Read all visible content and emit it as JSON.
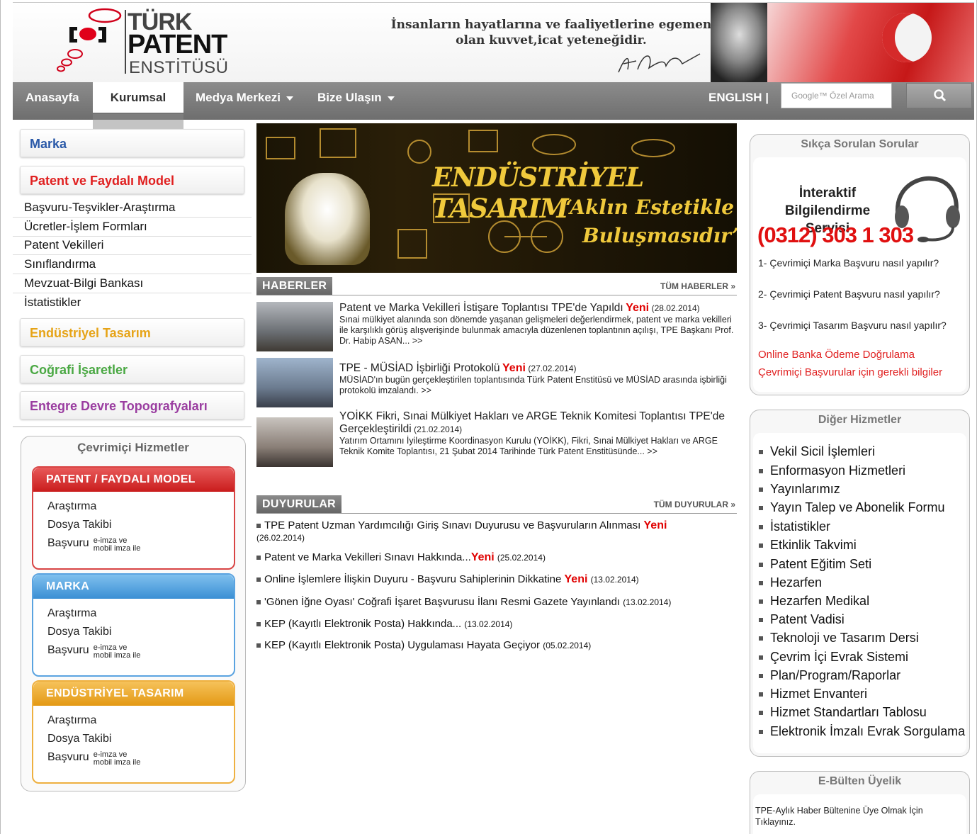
{
  "header": {
    "logo_line1": "TÜRK",
    "logo_line2": "PATENT",
    "logo_line3": "ENSTİTÜSÜ",
    "quote_line1": "İnsanların hayatlarına ve faaliyetlerine egemen",
    "quote_line2": "olan kuvvet,icat yeteneğidir."
  },
  "nav": {
    "items": [
      "Anasayfa",
      "Kurumsal",
      "Medya Merkezi",
      "Bize Ulaşın"
    ],
    "english": "ENGLISH |",
    "search_placeholder": "Google™ Özel Arama"
  },
  "left": {
    "buttons": [
      "Marka",
      "Patent ve Faydalı Model",
      "Endüstriyel Tasarım",
      "Coğrafi İşaretler",
      "Entegre Devre Topografyaları"
    ],
    "links": [
      "Başvuru-Teşvikler-Araştırma",
      "Ücretler-İşlem Formları",
      "Patent Vekilleri",
      "Sınıflandırma",
      "Mevzuat-Bilgi Bankası",
      "İstatistikler"
    ],
    "online_title": "Çevrimiçi Hizmetler",
    "boxes": [
      {
        "title": "PATENT / FAYDALI MODEL",
        "l1": "Araştırma",
        "l2": "Dosya Takibi",
        "l3": "Başvuru",
        "small1": "e-imza ve",
        "small2": "mobil imza ile"
      },
      {
        "title": "MARKA",
        "l1": "Araştırma",
        "l2": "Dosya Takibi",
        "l3": "Başvuru",
        "small1": "e-imza ve",
        "small2": "mobil imza ile"
      },
      {
        "title": "ENDÜSTRİYEL TASARIM",
        "l1": "Araştırma",
        "l2": "Dosya Takibi",
        "l3": "Başvuru",
        "small1": "e-imza ve",
        "small2": "mobil imza ile"
      }
    ]
  },
  "banner": {
    "line1": "ENDÜSTRİYEL TASARIM",
    "line2": "“Aklın Estetikle",
    "line3": "Buluşmasıdır”"
  },
  "news": {
    "tag": "HABERLER",
    "all": "TÜM HABERLER »",
    "yeni": "Yeni",
    "items": [
      {
        "title": "Patent ve Marka Vekilleri İstişare Toplantısı TPE'de Yapıldı",
        "date": "(28.02.2014)",
        "body": "Sınai mülkiyet alanında son dönemde yaşanan gelişmeleri değerlendirmek, patent ve marka vekilleri ile karşılıklı görüş alışverişinde bulunmak amacıyla düzenlenen toplantının açılışı, TPE Başkanı Prof. Dr. Habip ASAN... >>"
      },
      {
        "title": "TPE - MÜSİAD İşbirliği Protokolü",
        "date": "(27.02.2014)",
        "body": "MÜSİAD'ın bugün gerçekleştirilen toplantısında Türk Patent Enstitüsü ve MÜSİAD arasında işbirliği protokolü imzalandı. >>"
      },
      {
        "title": "YOİKK Fikri, Sınai Mülkiyet Hakları ve ARGE Teknik Komitesi Toplantısı TPE'de Gerçekleştirildi",
        "date": "(21.02.2014)",
        "body": "Yatırım Ortamını İyileştirme Koordinasyon Kurulu (YOİKK), Fikri, Sınai Mülkiyet Hakları ve ARGE Teknik Komite Toplantısı, 21 Şubat 2014 Tarihinde Türk Patent Enstitüsünde... >>"
      }
    ]
  },
  "announcements": {
    "tag": "DUYURULAR",
    "all": "TÜM DUYURULAR »",
    "items": [
      {
        "title": "TPE Patent Uzman Yardımcılığı Giriş Sınavı Duyurusu ve Başvuruların Alınması",
        "yeni": "Yeni",
        "date": "(26.02.2014)"
      },
      {
        "title": "Patent ve Marka Vekilleri Sınavı Hakkında...",
        "yeni": "Yeni",
        "date": "(25.02.2014)"
      },
      {
        "title": "Online İşlemlere İlişkin Duyuru - Başvuru Sahiplerinin Dikkatine",
        "yeni": "Yeni",
        "date": "(13.02.2014)"
      },
      {
        "title": "'Gönen İğne Oyası' Coğrafi İşaret Başvurusu İlanı Resmi Gazete Yayınlandı",
        "yeni": "",
        "date": "(13.02.2014)"
      },
      {
        "title": "KEP (Kayıtlı Elektronik Posta) Hakkında...",
        "yeni": "",
        "date": "(13.02.2014)"
      },
      {
        "title": "KEP (Kayıtlı Elektronik Posta) Uygulaması Hayata Geçiyor",
        "yeni": "",
        "date": "(05.02.2014)"
      }
    ]
  },
  "faq": {
    "title": "Sıkça Sorulan Sorular",
    "service_line1": "İnteraktif Bilgilendirme",
    "service_line2": "Servisi",
    "phone": "(0312) 303 1 303",
    "q1": "1- Çevrimiçi Marka Başvuru nasıl yapılır?",
    "q2": "2- Çevrimiçi Patent Başvuru nasıl yapılır?",
    "q3": "3- Çevrimiçi Tasarım Başvuru nasıl yapılır?",
    "red1": "Online Banka Ödeme Doğrulama",
    "red2": "Çevrimiçi Başvurular için gerekli bilgiler"
  },
  "services": {
    "title": "Diğer Hizmetler",
    "items": [
      "Vekil Sicil İşlemleri",
      "Enformasyon Hizmetleri",
      "Yayınlarımız",
      "Yayın Talep ve Abonelik Formu",
      "İstatistikler",
      "Etkinlik Takvimi",
      "Patent Eğitim Seti",
      "Hezarfen",
      "Hezarfen Medikal",
      "Patent Vadisi",
      "Teknoloji ve Tasarım Dersi",
      "Çevrim İçi Evrak Sistemi",
      "Plan/Program/Raporlar",
      "Hizmet Envanteri",
      "Hizmet Standartları Tablosu",
      "Elektronik İmzalı Evrak Sorgulama"
    ]
  },
  "ebulten": {
    "title": "E-Bülten Üyelik",
    "text": "TPE-Aylık Haber Bültenine Üye Olmak İçin Tıklayınız."
  },
  "colors": {
    "red": "#e02020",
    "blue": "#2a59a8",
    "orange": "#e6a316",
    "green": "#4aa843",
    "purple": "#9a3da0"
  }
}
